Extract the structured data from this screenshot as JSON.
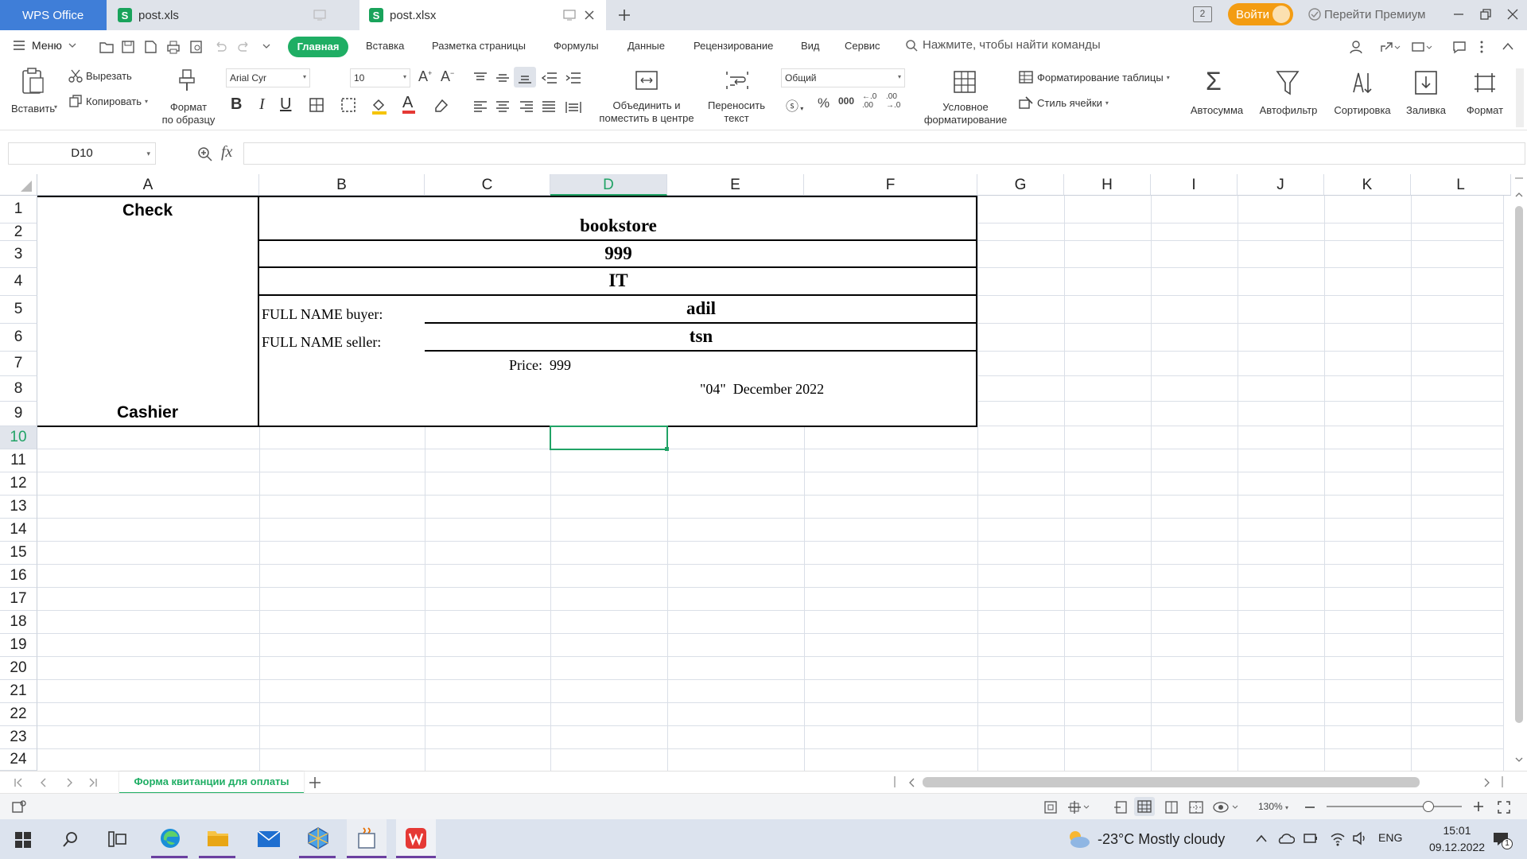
{
  "titlebar": {
    "tabs": [
      {
        "label": "WPS Office"
      },
      {
        "label": "post.xls"
      },
      {
        "label": "post.xlsx"
      }
    ],
    "page_badge": "2",
    "login_label": "Войти",
    "premium_label": "Перейти Премиум"
  },
  "menubar": {
    "menu_label": "Меню",
    "tabs": [
      "Главная",
      "Вставка",
      "Разметка страницы",
      "Формулы",
      "Данные",
      "Рецензирование",
      "Вид",
      "Сервис"
    ],
    "search_placeholder": "Нажмите, чтобы найти команды"
  },
  "ribbon": {
    "paste": "Вставить",
    "cut": "Вырезать",
    "copy": "Копировать",
    "format_painter_1": "Формат",
    "format_painter_2": "по образцу",
    "font_name": "Arial Cyr",
    "font_size": "10",
    "merge_1": "Объединить и",
    "merge_2": "поместить в центре",
    "wrap_1": "Переносить",
    "wrap_2": "текст",
    "number_format": "Общий",
    "cond_format_1": "Условное",
    "cond_format_2": "форматирование",
    "table_format": "Форматирование таблицы",
    "cell_style": "Стиль ячейки",
    "autosum": "Автосумма",
    "autofilter": "Автофильтр",
    "sort": "Сортировка",
    "fill": "Заливка",
    "format": "Формат"
  },
  "formula_bar": {
    "name_box": "D10",
    "fx": "fx",
    "value": ""
  },
  "sheet": {
    "columns": [
      "A",
      "B",
      "C",
      "D",
      "E",
      "F",
      "G",
      "H",
      "I",
      "J",
      "K",
      "L"
    ],
    "rows": [
      "1",
      "2",
      "3",
      "4",
      "5",
      "6",
      "7",
      "8",
      "9",
      "10",
      "11",
      "12",
      "13",
      "14",
      "15",
      "16",
      "17",
      "18",
      "19",
      "20",
      "21",
      "22",
      "23",
      "24"
    ],
    "selected_cell": "D10",
    "cells": {
      "check": "Check",
      "cashier": "Cashier",
      "bookstore": "bookstore",
      "num": "999",
      "it": "IT",
      "buyer_label": "FULL NAME buyer:",
      "buyer_value": "adil",
      "seller_label": "FULL NAME seller:",
      "seller_value": "tsn",
      "price": "Price:  999",
      "date": "\"04\"  December 2022"
    }
  },
  "sheet_tabs": {
    "active": "Форма квитанции для оплаты"
  },
  "statusbar": {
    "zoom": "130%",
    "zoom_level": 0.75
  },
  "taskbar": {
    "weather": "-23°C  Mostly cloudy",
    "language": "ENG",
    "time": "15:01",
    "date": "09.12.2022"
  },
  "colors": {
    "accent_green": "#1fae64",
    "wps_blue": "#3f7ed8",
    "login_orange": "#f39c12",
    "selection_green": "#21a366"
  }
}
